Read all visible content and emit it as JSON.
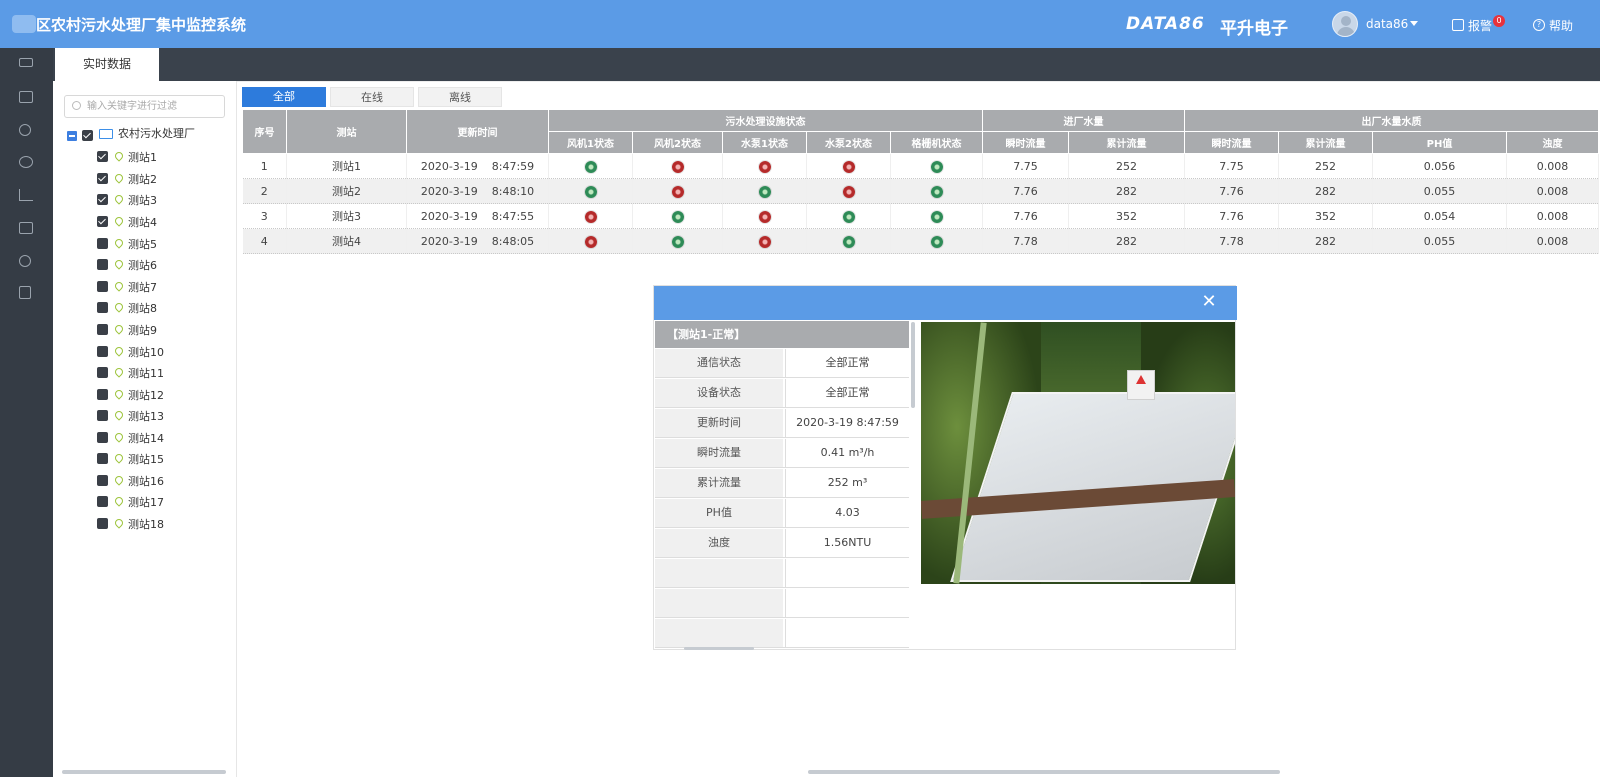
{
  "header": {
    "title": "区农村污水处理厂集中监控系统",
    "brand": "DATA86",
    "brand_cn": "平升电子",
    "user": "data86",
    "alarm_label": "报警",
    "alarm_count": "0",
    "help_label": "帮助"
  },
  "tabs": {
    "active": "实时数据"
  },
  "tree": {
    "search_placeholder": "输入关键字进行过滤",
    "root": "农村污水处理厂",
    "stations": [
      {
        "label": "测站1",
        "checked": true
      },
      {
        "label": "测站2",
        "checked": true
      },
      {
        "label": "测站3",
        "checked": true
      },
      {
        "label": "测站4",
        "checked": true
      },
      {
        "label": "测站5",
        "checked": false
      },
      {
        "label": "测站6",
        "checked": false
      },
      {
        "label": "测站7",
        "checked": false
      },
      {
        "label": "测站8",
        "checked": false
      },
      {
        "label": "测站9",
        "checked": false
      },
      {
        "label": "测站10",
        "checked": false
      },
      {
        "label": "测站11",
        "checked": false
      },
      {
        "label": "测站12",
        "checked": false
      },
      {
        "label": "测站13",
        "checked": false
      },
      {
        "label": "测站14",
        "checked": false
      },
      {
        "label": "测站15",
        "checked": false
      },
      {
        "label": "测站16",
        "checked": false
      },
      {
        "label": "测站17",
        "checked": false
      },
      {
        "label": "测站18",
        "checked": false
      }
    ]
  },
  "filters": [
    "全部",
    "在线",
    "离线"
  ],
  "table": {
    "group_headers": [
      "污水处理设施状态",
      "进厂水量",
      "出厂水量水质"
    ],
    "headers": [
      "序号",
      "测站",
      "更新时间",
      "风机1状态",
      "风机2状态",
      "水泵1状态",
      "水泵2状态",
      "格栅机状态",
      "瞬时流量",
      "累计流量",
      "瞬时流量",
      "累计流量",
      "PH值",
      "浊度"
    ],
    "rows": [
      {
        "no": "1",
        "station": "测站1",
        "date": "2020-3-19",
        "time": "8:47:59",
        "status": [
          "green",
          "red",
          "red",
          "red",
          "green"
        ],
        "in_flow": "7.75",
        "in_total": "252",
        "out_flow": "7.75",
        "out_total": "252",
        "ph": "0.056",
        "turbidity": "0.008"
      },
      {
        "no": "2",
        "station": "测站2",
        "date": "2020-3-19",
        "time": "8:48:10",
        "status": [
          "green",
          "red",
          "green",
          "red",
          "green"
        ],
        "in_flow": "7.76",
        "in_total": "282",
        "out_flow": "7.76",
        "out_total": "282",
        "ph": "0.055",
        "turbidity": "0.008"
      },
      {
        "no": "3",
        "station": "测站3",
        "date": "2020-3-19",
        "time": "8:47:55",
        "status": [
          "red",
          "green",
          "red",
          "green",
          "green"
        ],
        "in_flow": "7.76",
        "in_total": "352",
        "out_flow": "7.76",
        "out_total": "352",
        "ph": "0.054",
        "turbidity": "0.008"
      },
      {
        "no": "4",
        "station": "测站4",
        "date": "2020-3-19",
        "time": "8:48:05",
        "status": [
          "red",
          "green",
          "red",
          "green",
          "green"
        ],
        "in_flow": "7.78",
        "in_total": "282",
        "out_flow": "7.78",
        "out_total": "282",
        "ph": "0.055",
        "turbidity": "0.008"
      }
    ]
  },
  "popup": {
    "title": "【测站1-正常】",
    "rows": [
      {
        "k": "通信状态",
        "v": "全部正常"
      },
      {
        "k": "设备状态",
        "v": "全部正常"
      },
      {
        "k": "更新时间",
        "v": "2020-3-19  8:47:59"
      },
      {
        "k": "瞬时流量",
        "v": "0.41  m³/h"
      },
      {
        "k": "累计流量",
        "v": "252  m³"
      },
      {
        "k": "PH值",
        "v": "4.03"
      },
      {
        "k": "浊度",
        "v": "1.56NTU"
      },
      {
        "k": "",
        "v": ""
      },
      {
        "k": "",
        "v": ""
      },
      {
        "k": "",
        "v": ""
      }
    ]
  },
  "nav_icons": [
    "list-icon",
    "monitor-icon",
    "map-pin-icon",
    "pie-chart-icon",
    "bar-chart-icon",
    "book-icon",
    "gear-icon",
    "report-icon"
  ],
  "status_colors": {
    "green": "#2e8b57",
    "red": "#b52a2a"
  }
}
